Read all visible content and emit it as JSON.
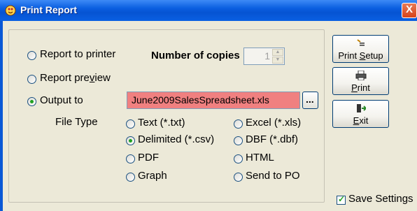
{
  "window": {
    "title": "Print Report",
    "close_label": "X"
  },
  "dest": {
    "printer": "Report to printer",
    "preview_pre": "Report pre",
    "preview_ul": "v",
    "preview_post": "iew",
    "output": "Output to",
    "selected": "output"
  },
  "copies": {
    "label": "Number of copies",
    "value": "1"
  },
  "output_file": "June2009SalesSpreadsheet.xls",
  "browse_label": "...",
  "file_type": {
    "label": "File Type",
    "options": [
      "Text (*.txt)",
      "Excel (*.xls)",
      "Delimited (*.csv)",
      "DBF (*.dbf)",
      "PDF",
      "HTML",
      "Graph",
      "Send to PO"
    ],
    "selected": "Delimited (*.csv)"
  },
  "buttons": {
    "setup_pre": "Print ",
    "setup_ul": "S",
    "setup_post": "etup",
    "print_ul": "P",
    "print_post": "rint",
    "exit_ul": "E",
    "exit_post": "xit"
  },
  "save_settings": {
    "label": "Save Settings",
    "checked": true
  },
  "colors": {
    "output_field": "#f08080",
    "titlebar": "#0a5ee0",
    "radio_dot": "#21a121"
  }
}
